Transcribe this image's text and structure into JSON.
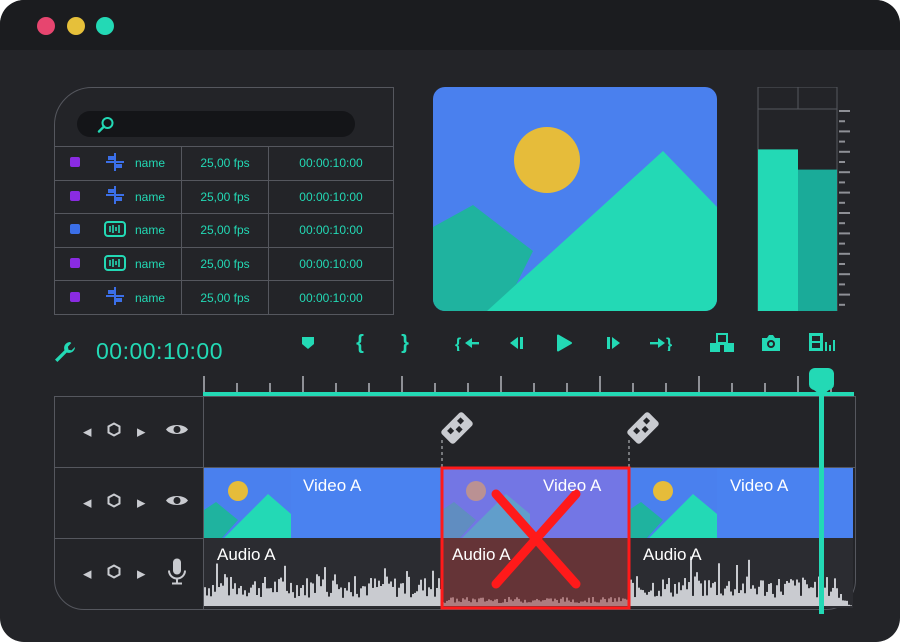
{
  "window": {
    "traffic_lights": [
      "#e7456f",
      "#e6c03a",
      "#23d9b5"
    ]
  },
  "media_bin": {
    "search_icon": "search-icon",
    "rows": [
      {
        "swatch": "#8a2be2",
        "icon": "align-icon",
        "name": "name",
        "fps": "25,00 fps",
        "duration": "00:00:10:00"
      },
      {
        "swatch": "#8a2be2",
        "icon": "align-icon",
        "name": "name",
        "fps": "25,00 fps",
        "duration": "00:00:10:00"
      },
      {
        "swatch": "#3b6fe8",
        "icon": "audio-clip-icon",
        "name": "name",
        "fps": "25,00 fps",
        "duration": "00:00:10:00"
      },
      {
        "swatch": "#8a2be2",
        "icon": "audio-clip-icon",
        "name": "name",
        "fps": "25,00 fps",
        "duration": "00:00:10:00"
      },
      {
        "swatch": "#8a2be2",
        "icon": "align-icon",
        "name": "name",
        "fps": "25,00 fps",
        "duration": "00:00:10:00"
      }
    ]
  },
  "audio_meter": {
    "left_level": 0.8,
    "right_level": 0.7
  },
  "toolbar": {
    "timecode": "00:00:10:00",
    "buttons": [
      "marker-icon",
      "mark-in-icon",
      "mark-out-icon",
      "go-to-in-icon",
      "step-back-icon",
      "play-icon",
      "step-forward-icon",
      "go-to-out-icon",
      "lift-icon",
      "snapshot-icon",
      "export-frame-icon"
    ]
  },
  "timeline": {
    "playhead_position": "00:00:10:00",
    "tracks": {
      "video": [
        {
          "label": "Video A",
          "state": "normal"
        },
        {
          "label": "Video A",
          "state": "deleted"
        },
        {
          "label": "Video A",
          "state": "normal"
        }
      ],
      "audio": [
        {
          "label": "Audio A",
          "state": "normal"
        },
        {
          "label": "Audio A",
          "state": "deleted"
        },
        {
          "label": "Audio A",
          "state": "normal"
        }
      ]
    }
  },
  "colors": {
    "accent": "#23d9b5",
    "clip_blue": "#4a82f0",
    "delete_red": "#ff1a1a"
  }
}
